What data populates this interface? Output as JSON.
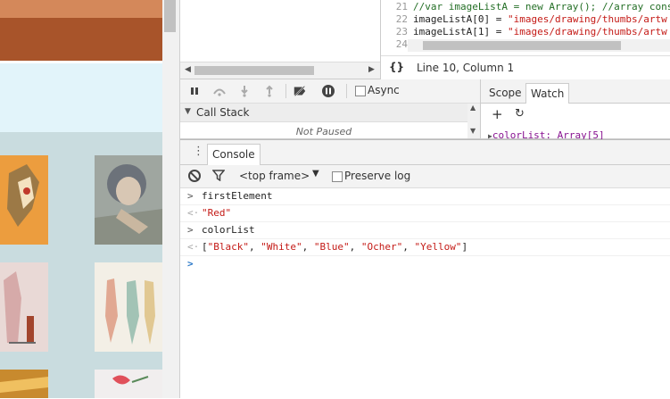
{
  "editor": {
    "lines": [
      {
        "num": "21",
        "text": "//var imageListA = new Array(); //array cons"
      },
      {
        "num": "22",
        "pre": "imageListA[0] = ",
        "str": "\"images/drawing/thumbs/artw"
      },
      {
        "num": "23",
        "pre": "imageListA[1] = ",
        "str": "\"images/drawing/thumbs/artw"
      },
      {
        "num": "24",
        "text": ""
      }
    ],
    "pretty_print": "{}",
    "cursor_position": "Line 10, Column 1"
  },
  "debugger": {
    "async_label": "Async",
    "call_stack_label": "Call Stack",
    "not_paused": "Not Paused"
  },
  "sidebar": {
    "tabs": [
      "Scope",
      "Watch"
    ],
    "active_tab": "Watch",
    "watch_item": "colorList: Array[5]"
  },
  "console": {
    "tab_label": "Console",
    "context": "<top frame>",
    "preserve_log_label": "Preserve log",
    "entries": [
      {
        "type": "input",
        "prefix": ">",
        "text": "firstElement"
      },
      {
        "type": "output",
        "prefix": "<·",
        "string": "\"Red\""
      },
      {
        "type": "input",
        "prefix": ">",
        "text": "colorList"
      },
      {
        "type": "output",
        "prefix": "<·",
        "array": [
          "\"Black\"",
          "\"White\"",
          "\"Blue\"",
          "\"Ocher\"",
          "\"Yellow\""
        ]
      }
    ],
    "prompt": ">"
  },
  "colors": {
    "string": "#c41a16",
    "comment": "#236e25",
    "prompt": "#2a78c8",
    "banner": "#a8542a",
    "page_bg": "#c9dcdf"
  }
}
